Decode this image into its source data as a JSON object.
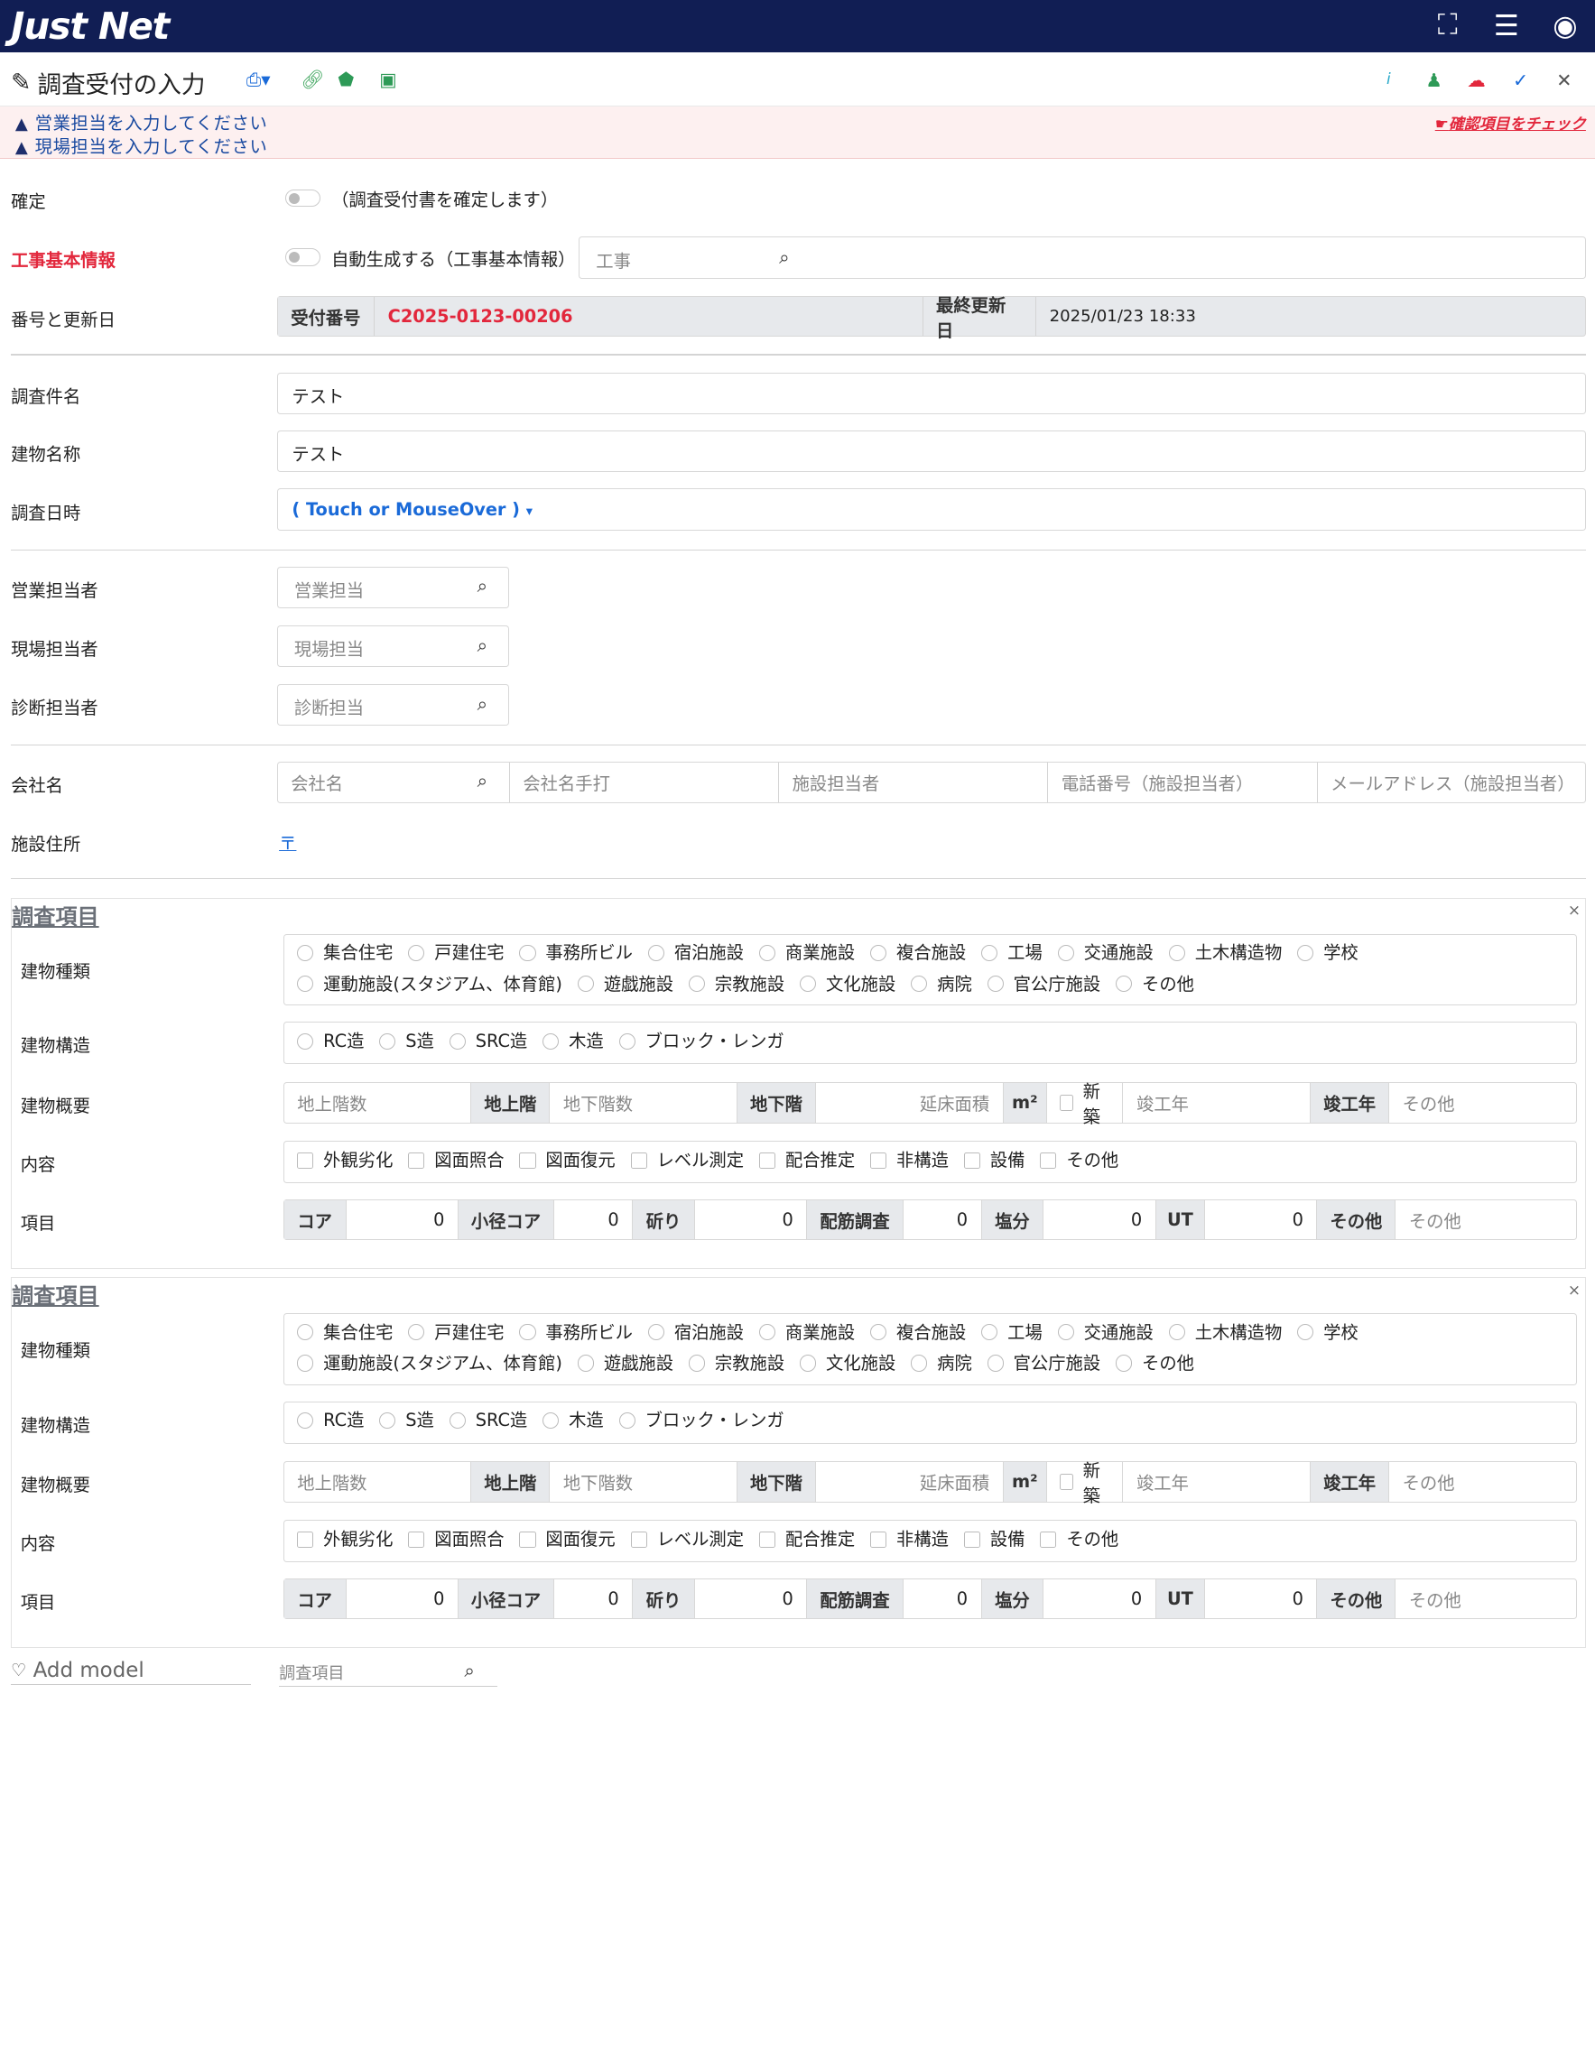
{
  "app": {
    "logo": "Just Net"
  },
  "topbar": {
    "icons": [
      "expand-icon",
      "database-icon",
      "user-circle-icon"
    ]
  },
  "title": {
    "text": "調査受付の入力"
  },
  "alerts": {
    "items": [
      "営業担当を入力してください",
      "現場担当を入力してください"
    ],
    "check_link": "確認項目をチェック"
  },
  "form": {
    "confirm": {
      "label": "確定",
      "toggle_text": "（調査受付書を確定します）"
    },
    "construction": {
      "label": "工事基本情報",
      "toggle_text": "自動生成する（工事基本情報）",
      "search_placeholder": "工事"
    },
    "number": {
      "label": "番号と更新日",
      "receipt_label": "受付番号",
      "receipt_value": "C2025-0123-00206",
      "updated_label": "最終更新日",
      "updated_value": "2025/01/23 18:33"
    },
    "survey_name": {
      "label": "調査件名",
      "value": "テスト"
    },
    "building_name": {
      "label": "建物名称",
      "value": "テスト"
    },
    "survey_date": {
      "label": "調査日時",
      "value": "( Touch or MouseOver )"
    },
    "sales": {
      "label": "営業担当者",
      "placeholder": "営業担当"
    },
    "site": {
      "label": "現場担当者",
      "placeholder": "現場担当"
    },
    "diagnosis": {
      "label": "診断担当者",
      "placeholder": "診断担当"
    },
    "company": {
      "label": "会社名",
      "placeholders": [
        "会社名",
        "会社名手打",
        "施設担当者",
        "電話番号（施設担当者）",
        "メールアドレス（施設担当者）"
      ]
    },
    "address": {
      "label": "施設住所",
      "postal": "〒"
    }
  },
  "survey_panels": [
    {
      "title": "調査項目",
      "building_type_label": "建物種類",
      "building_types_row1": [
        "集合住宅",
        "戸建住宅",
        "事務所ビル",
        "宿泊施設",
        "商業施設",
        "複合施設",
        "工場",
        "交通施設",
        "土木構造物",
        "学校"
      ],
      "building_types_row2": [
        "運動施設(スタジアム、体育館)",
        "遊戯施設",
        "宗教施設",
        "文化施設",
        "病院",
        "官公庁施設",
        "その他"
      ],
      "structure_label": "建物構造",
      "structures": [
        "RC造",
        "S造",
        "SRC造",
        "木造",
        "ブロック・レンガ"
      ],
      "overview_label": "建物概要",
      "overview": {
        "above_ph": "地上階数",
        "above_unit": "地上階",
        "below_ph": "地下階数",
        "below_unit": "地下階",
        "area_ph": "延床面積",
        "area_unit": "m²",
        "new_label": "新築",
        "year_ph": "竣工年",
        "year_unit": "竣工年",
        "other_ph": "その他"
      },
      "content_label": "内容",
      "contents": [
        "外観劣化",
        "図面照合",
        "図面復元",
        "レベル測定",
        "配合推定",
        "非構造",
        "設備",
        "その他"
      ],
      "items_label": "項目",
      "items": [
        {
          "name": "コア",
          "value": "0"
        },
        {
          "name": "小径コア",
          "value": "0"
        },
        {
          "name": "斫り",
          "value": "0"
        },
        {
          "name": "配筋調査",
          "value": "0"
        },
        {
          "name": "塩分",
          "value": "0"
        },
        {
          "name": "UT",
          "value": "0"
        }
      ],
      "items_other_label": "その他",
      "items_other_ph": "その他"
    },
    {
      "title": "調査項目",
      "building_type_label": "建物種類",
      "building_types_row1": [
        "集合住宅",
        "戸建住宅",
        "事務所ビル",
        "宿泊施設",
        "商業施設",
        "複合施設",
        "工場",
        "交通施設",
        "土木構造物",
        "学校"
      ],
      "building_types_row2": [
        "運動施設(スタジアム、体育館)",
        "遊戯施設",
        "宗教施設",
        "文化施設",
        "病院",
        "官公庁施設",
        "その他"
      ],
      "structure_label": "建物構造",
      "structures": [
        "RC造",
        "S造",
        "SRC造",
        "木造",
        "ブロック・レンガ"
      ],
      "overview_label": "建物概要",
      "overview": {
        "above_ph": "地上階数",
        "above_unit": "地上階",
        "below_ph": "地下階数",
        "below_unit": "地下階",
        "area_ph": "延床面積",
        "area_unit": "m²",
        "new_label": "新築",
        "year_ph": "竣工年",
        "year_unit": "竣工年",
        "other_ph": "その他"
      },
      "content_label": "内容",
      "contents": [
        "外観劣化",
        "図面照合",
        "図面復元",
        "レベル測定",
        "配合推定",
        "非構造",
        "設備",
        "その他"
      ],
      "items_label": "項目",
      "items": [
        {
          "name": "コア",
          "value": "0"
        },
        {
          "name": "小径コア",
          "value": "0"
        },
        {
          "name": "斫り",
          "value": "0"
        },
        {
          "name": "配筋調査",
          "value": "0"
        },
        {
          "name": "塩分",
          "value": "0"
        },
        {
          "name": "UT",
          "value": "0"
        }
      ],
      "items_other_label": "その他",
      "items_other_ph": "その他"
    }
  ],
  "footer": {
    "add_model": "Add model",
    "search_placeholder": "調査項目"
  }
}
